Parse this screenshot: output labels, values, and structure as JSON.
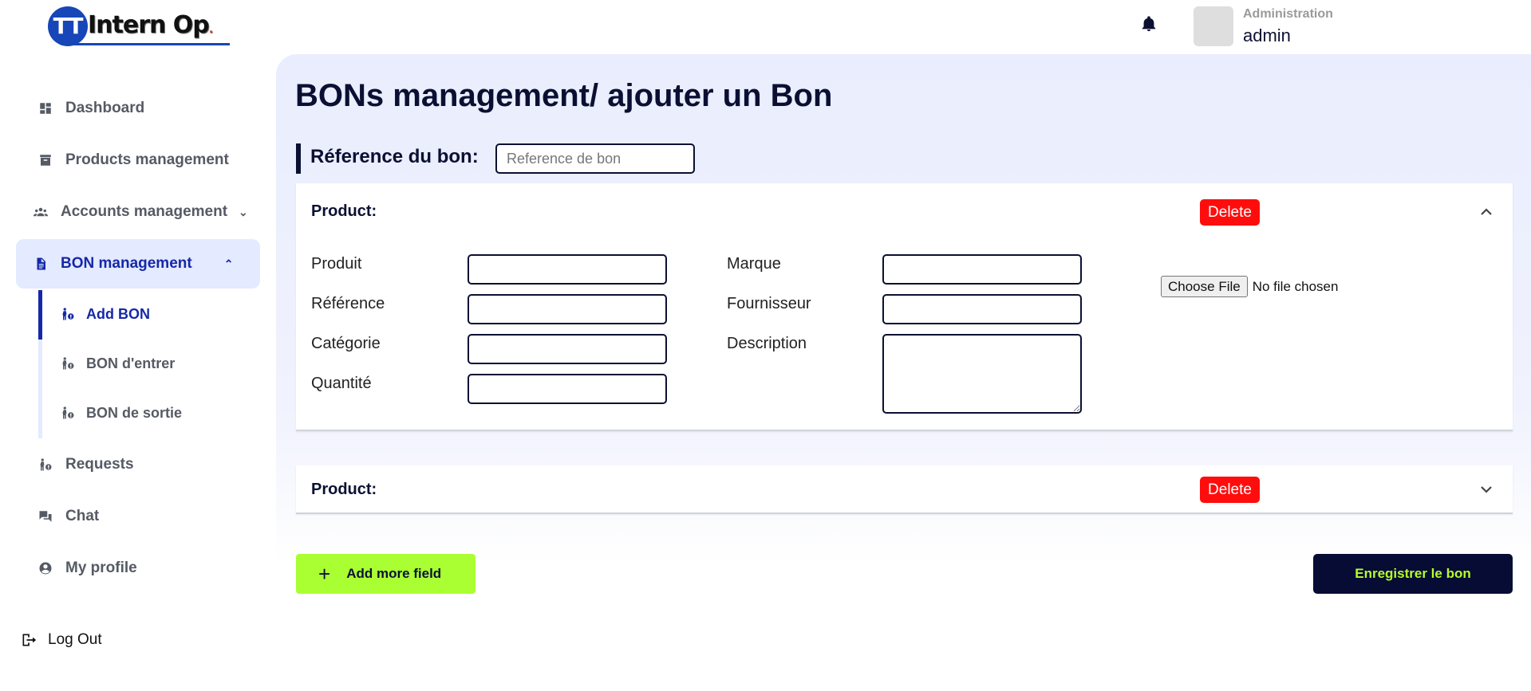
{
  "logo": {
    "initials": "TT",
    "name": "Intern Op",
    "dot": "."
  },
  "header": {
    "role": "Administration",
    "username": "admin"
  },
  "sidebar": {
    "items": [
      {
        "label": "Dashboard",
        "icon": "dashboard-icon"
      },
      {
        "label": "Products management",
        "icon": "archive-box-icon"
      },
      {
        "label": "Accounts management",
        "icon": "users-group-icon",
        "chevron": "⌄"
      },
      {
        "label": "BON management",
        "icon": "document-icon",
        "chevron": "⌃",
        "active": true
      },
      {
        "label": "Requests",
        "icon": "person-request-icon"
      },
      {
        "label": "Chat",
        "icon": "chat-bubbles-icon"
      },
      {
        "label": "My profile",
        "icon": "user-circle-icon"
      }
    ],
    "subitems": [
      {
        "label": "Add BON",
        "active": true
      },
      {
        "label": "BON d'entrer"
      },
      {
        "label": "BON de sortie"
      }
    ],
    "logout": "Log Out"
  },
  "main": {
    "title": "BONs management/ ajouter un Bon",
    "reference": {
      "label": "Réference du bon:",
      "placeholder": "Reference de bon",
      "value": ""
    },
    "products": [
      {
        "title": "Product:",
        "delete_label": "Delete",
        "expanded": true,
        "fields": {
          "produit": {
            "label": "Produit",
            "value": ""
          },
          "reference": {
            "label": "Référence",
            "value": ""
          },
          "categorie": {
            "label": "Catégorie",
            "value": ""
          },
          "quantite": {
            "label": "Quantité",
            "value": ""
          },
          "marque": {
            "label": "Marque",
            "value": ""
          },
          "fournisseur": {
            "label": "Fournisseur",
            "value": ""
          },
          "description": {
            "label": "Description",
            "value": ""
          }
        },
        "file": {
          "button": "Choose File",
          "status": "No file chosen"
        }
      },
      {
        "title": "Product:",
        "delete_label": "Delete",
        "expanded": false
      }
    ],
    "add_button": {
      "icon": "+",
      "label": "Add more field"
    },
    "save_button": "Enregistrer le bon"
  },
  "colors": {
    "accent": "#1528a8",
    "navy": "#0b1033",
    "danger": "#ff0d0d",
    "lime": "#aaff33",
    "active_bg": "#e4eaff"
  }
}
